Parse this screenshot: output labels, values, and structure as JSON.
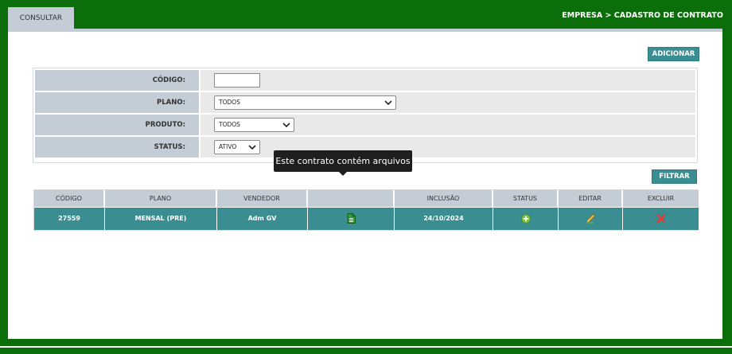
{
  "tabs": {
    "consultar": "CONSULTAR"
  },
  "breadcrumb": "EMPRESA > CADASTRO DE CONTRATO",
  "buttons": {
    "adicionar": "ADICIONAR",
    "filtrar": "FILTRAR"
  },
  "form": {
    "codigo_label": "CÓDIGO:",
    "codigo_value": "",
    "plano_label": "PLANO:",
    "plano_value": "TODOS",
    "produto_label": "PRODUTO:",
    "produto_value": "TODOS",
    "status_label": "STATUS:",
    "status_value": "ATIVO"
  },
  "table": {
    "headers": [
      "CÓDIGO",
      "PLANO",
      "VENDEDOR",
      "",
      "INCLUSÃO",
      "STATUS",
      "EDITAR",
      "EXCLUIR"
    ],
    "rows": [
      {
        "codigo": "27559",
        "plano": "MENSAL (PRE)",
        "vendedor": "Adm GV",
        "arquivo_icon": "file-icon",
        "inclusao": "24/10/2024",
        "status_icon": "add-circle-icon",
        "editar_icon": "pencil-icon",
        "excluir_icon": "delete-x-icon"
      }
    ]
  },
  "tooltip": "Este contrato contém arquivos",
  "colors": {
    "header_green": "#0b6e0b",
    "teal": "#3a8e91",
    "label_gray": "#c4cdd6",
    "field_gray": "#e9e9e9"
  }
}
